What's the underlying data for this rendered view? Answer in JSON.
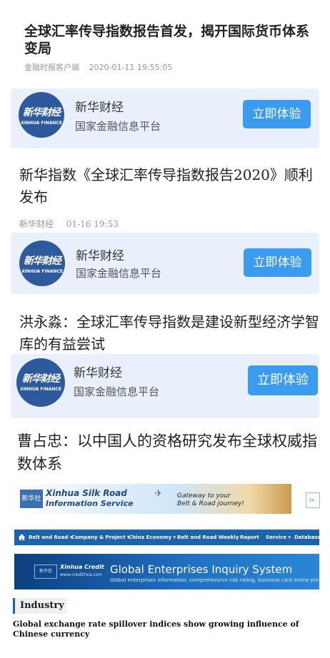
{
  "article": {
    "title": "全球汇率传导指数报告首发，揭开国际货币体系变局",
    "source": "金融时报客户端",
    "datetime": "2020-01-11 19:55:05"
  },
  "banners": [
    {
      "name": "新华财经",
      "subtitle": "国家金融信息平台",
      "button": "立即体验",
      "logo_cn": "新华财经",
      "logo_en": "XINHUA FINANCE"
    },
    {
      "name": "新华财经",
      "subtitle": "国家金融信息平台",
      "button": "立即体验",
      "logo_cn": "新华财经",
      "logo_en": "XINHUA FINANCE"
    },
    {
      "name": "新华财经",
      "subtitle": "国家金融信息平台",
      "button": "立即体验",
      "logo_cn": "新华财经",
      "logo_en": "XINHUA FINANCE"
    }
  ],
  "sections": [
    {
      "headline": "新华指数《全球汇率传导指数报告2020》顺利发布",
      "source": "新华财经",
      "time": "01-16 19:53"
    },
    {
      "headline": "洪永淼：全球汇率传导指数是建设新型经济学智库的有益尝试"
    },
    {
      "headline": "曹占忠：以中国人的资格研究发布全球权威指数体系"
    }
  ],
  "silk_banner": {
    "logo": "新华社",
    "title1": "Xinhua Silk Road",
    "title2": "Information Service",
    "slogan1": "Gateway to your",
    "slogan2": "Belt & Road journey!",
    "search_placeholder": "Se"
  },
  "nav": {
    "items": [
      "Belt and Road ▾",
      "Company & Project ▾",
      "China Economy ▾",
      "Belt and Road Weekly",
      "Report",
      "Service ▾",
      "Database"
    ]
  },
  "credit_banner": {
    "logo": "新华信",
    "name": "Xinhua Credit",
    "url": "www.credithxa.com",
    "title": "Global Enterprises Inquiry System",
    "subtitle": "Global enterprises information, comprehensive risk rating, business card online pre"
  },
  "industry": {
    "label": "Industry",
    "headline": "Global exchange rate spillover indices show growing influence of Chinese currency"
  },
  "colors": {
    "accent": "#3b9bef",
    "banner_bg": "#e9f0fb",
    "nav_bg": "#1d63aa",
    "logo_bg": "#2d5a9c"
  }
}
